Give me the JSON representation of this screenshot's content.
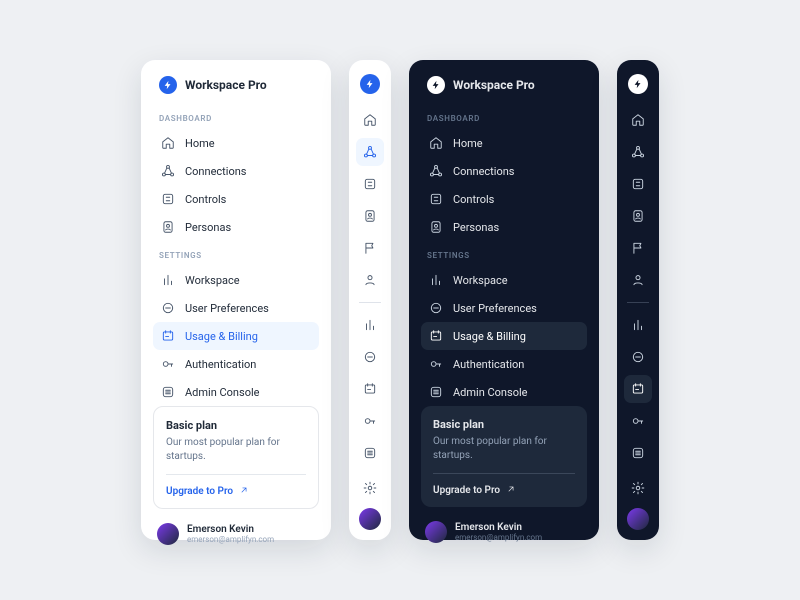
{
  "brand": {
    "name": "Workspace Pro"
  },
  "sections": {
    "dashboard_label": "DASHBOARD",
    "settings_label": "SETTINGS"
  },
  "nav": {
    "dashboard": [
      {
        "label": "Home"
      },
      {
        "label": "Connections"
      },
      {
        "label": "Controls"
      },
      {
        "label": "Personas"
      }
    ],
    "settings": [
      {
        "label": "Workspace"
      },
      {
        "label": "User Preferences"
      },
      {
        "label": "Usage & Billing"
      },
      {
        "label": "Authentication"
      },
      {
        "label": "Admin Console"
      }
    ]
  },
  "plan": {
    "title": "Basic plan",
    "desc": "Our most popular plan for startups.",
    "cta": "Upgrade to Pro"
  },
  "user": {
    "name": "Emerson Kevin",
    "email": "emerson@amplifyn.com"
  },
  "colors": {
    "accent": "#2563eb",
    "dark_bg": "#0f172a"
  }
}
